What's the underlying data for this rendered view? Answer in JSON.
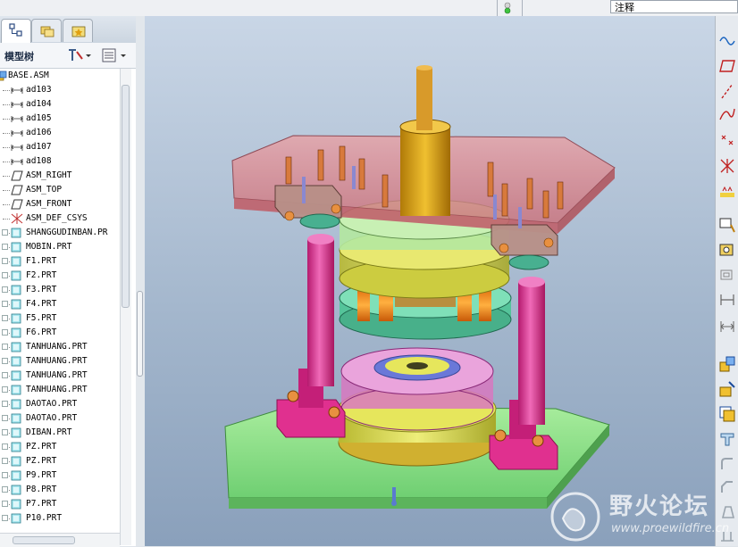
{
  "toolbar": {
    "annotation_field": "注释"
  },
  "model_tree": {
    "title": "模型树",
    "items": [
      {
        "label": "BASE.ASM",
        "type": "asm"
      },
      {
        "label": "ad103",
        "type": "dim"
      },
      {
        "label": "ad104",
        "type": "dim"
      },
      {
        "label": "ad105",
        "type": "dim"
      },
      {
        "label": "ad106",
        "type": "dim"
      },
      {
        "label": "ad107",
        "type": "dim"
      },
      {
        "label": "ad108",
        "type": "dim"
      },
      {
        "label": "ASM_RIGHT",
        "type": "plane"
      },
      {
        "label": "ASM_TOP",
        "type": "plane"
      },
      {
        "label": "ASM_FRONT",
        "type": "plane"
      },
      {
        "label": "ASM_DEF_CSYS",
        "type": "csys"
      },
      {
        "label": "SHANGGUDINBAN.PR",
        "type": "part"
      },
      {
        "label": "MOBIN.PRT",
        "type": "part"
      },
      {
        "label": "F1.PRT",
        "type": "part"
      },
      {
        "label": "F2.PRT",
        "type": "part"
      },
      {
        "label": "F3.PRT",
        "type": "part"
      },
      {
        "label": "F4.PRT",
        "type": "part"
      },
      {
        "label": "F5.PRT",
        "type": "part"
      },
      {
        "label": "F6.PRT",
        "type": "part"
      },
      {
        "label": "TANHUANG.PRT",
        "type": "part"
      },
      {
        "label": "TANHUANG.PRT",
        "type": "part"
      },
      {
        "label": "TANHUANG.PRT",
        "type": "part"
      },
      {
        "label": "TANHUANG.PRT",
        "type": "part"
      },
      {
        "label": "DAOTAO.PRT",
        "type": "part"
      },
      {
        "label": "DAOTAO.PRT",
        "type": "part"
      },
      {
        "label": "DIBAN.PRT",
        "type": "part"
      },
      {
        "label": "PZ.PRT",
        "type": "part"
      },
      {
        "label": "PZ.PRT",
        "type": "part"
      },
      {
        "label": "P9.PRT",
        "type": "part"
      },
      {
        "label": "P8.PRT",
        "type": "part"
      },
      {
        "label": "P7.PRT",
        "type": "part"
      },
      {
        "label": "P10.PRT",
        "type": "part"
      }
    ]
  },
  "watermark": {
    "text": "野火论坛",
    "url": "www.proewildfire.cn"
  },
  "colors": {
    "top_plate": "#e08a8a",
    "base_plate": "#8ee08e",
    "pillar": "#e0308f",
    "die_yellow": "#e0e050",
    "die_green": "#5fd4a8",
    "punch": "#d4a010"
  }
}
